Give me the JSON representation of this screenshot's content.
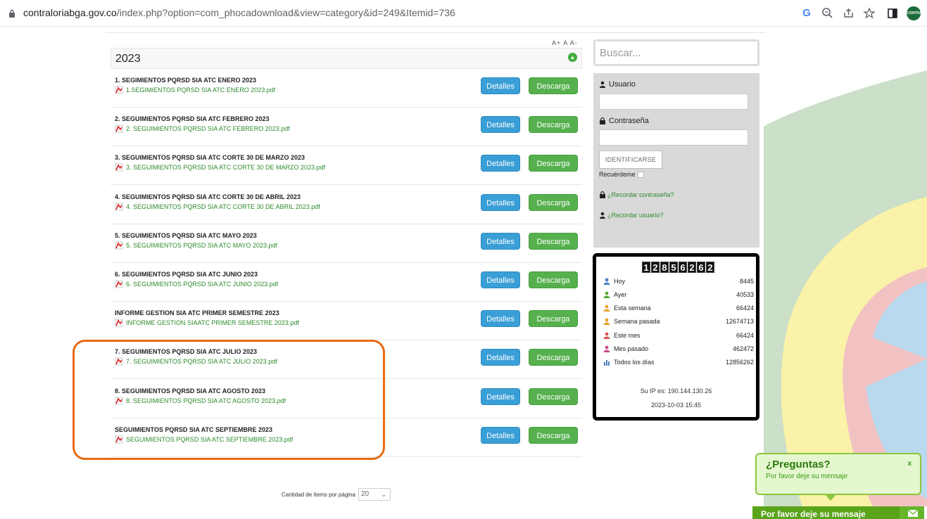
{
  "browser": {
    "url_host": "contraloriabga.gov.co",
    "url_path": "/index.php?option=com_phocadownload&view=category&id=249&Itemid=736",
    "ext_label": "CONTRA"
  },
  "font_controls": "A+  A  A-",
  "category": {
    "title": "2023"
  },
  "buttons": {
    "details": "Detalles",
    "download": "Descarga"
  },
  "documents": [
    {
      "title": "1. SEGIMIENTOS PQRSD SIA ATC ENERO 2023",
      "file": "1.SEGIMIENTOS PQRSD SIA ATC ENERO 2023.pdf"
    },
    {
      "title": "2. SEGUIMIENTOS PQRSD SIA ATC FEBRERO 2023",
      "file": "2. SEGUIMIENTOS PQRSD SIA ATC FEBRERO 2023.pdf"
    },
    {
      "title": "3. SEGUIMIENTOS PQRSD SIA ATC CORTE 30 DE MARZO 2023",
      "file": "3. SEGUIMIENTOS PQRSD SIA ATC CORTE 30 DE MARZO 2023.pdf"
    },
    {
      "title": "4. SEGUIMIENTOS PQRSD SIA ATC CORTE 30 DE ABRIL 2023",
      "file": "4. SEGUIMIENTOS PQRSD SIA ATC CORTE 30 DE ABRIL 2023.pdf"
    },
    {
      "title": "5. SEGUIMIENTOS PQRSD SIA ATC MAYO 2023",
      "file": "5. SEGUIMIENTOS PQRSD SIA ATC MAYO 2023.pdf"
    },
    {
      "title": "6. SEGUIMIENTOS PQRSD SIA ATC JUNIO 2023",
      "file": "6. SEGUIMIENTOS PQRSD SIA ATC JUNIO 2023.pdf"
    },
    {
      "title": "INFORME GESTION SIA ATC PRIMER SEMESTRE 2023",
      "file": "INFORME GESTION SIAATC PRIMER SEMESTRE 2023.pdf"
    },
    {
      "title": "7. SEGUIMIENTOS PQRSD SIA ATC JULIO 2023",
      "file": "7. SEGUIMIENTOS PQRSD SIA ATC JULIO 2023.pdf"
    },
    {
      "title": "8. SEGUIMIENTOS PQRSD SIA ATC AGOSTO 2023",
      "file": "8. SEGUIMIENTOS PQRSD SIA ATC AGOSTO 2023.pdf"
    },
    {
      "title": "SEGUIMIENTOS PQRSD SIA ATC SEPTIEMBRE 2023",
      "file": "SEGUIMIENTOS PQRSD SIA ATC SEPTIEMBRE 2023.pdf"
    }
  ],
  "pagination": {
    "label": "Cantidad de ítems por página",
    "value": "20"
  },
  "search": {
    "placeholder": "Buscar..."
  },
  "login": {
    "user_label": "Usuario",
    "pass_label": "Contraseña",
    "submit": "IDENTIFICARSE",
    "remember": "Recuérdeme",
    "forgot_pass": "¿Recordar contraseña?",
    "forgot_user": "¿Recordar usuario?"
  },
  "counter": {
    "total_digits": "12856262",
    "rows": [
      {
        "label": "Hoy",
        "value": "8445",
        "color": "#4a7fc1"
      },
      {
        "label": "Ayer",
        "value": "40533",
        "color": "#5aa83a"
      },
      {
        "label": "Esta semana",
        "value": "66424",
        "color": "#e8a12a"
      },
      {
        "label": "Semana pasada",
        "value": "12674713",
        "color": "#e8a12a"
      },
      {
        "label": "Este mes",
        "value": "66424",
        "color": "#d9534f"
      },
      {
        "label": "Mes pasado",
        "value": "462472",
        "color": "#c94a8a"
      },
      {
        "label": "Todos los días",
        "value": "12856262",
        "color": "#4a7fc1"
      }
    ],
    "ip": "Su IP es: 190.144.130.26",
    "datetime": "2023-10-03 15:45"
  },
  "chat": {
    "heading": "¿Preguntas?",
    "sub": "Por favor deje su mensaje",
    "close": "x",
    "bar": "Por favor deje su mensaje"
  },
  "colors": {
    "details_button": "#3a9fd6",
    "download_button": "#56b04e",
    "highlight": "#e86b14",
    "link_green": "#2c8a2c"
  }
}
